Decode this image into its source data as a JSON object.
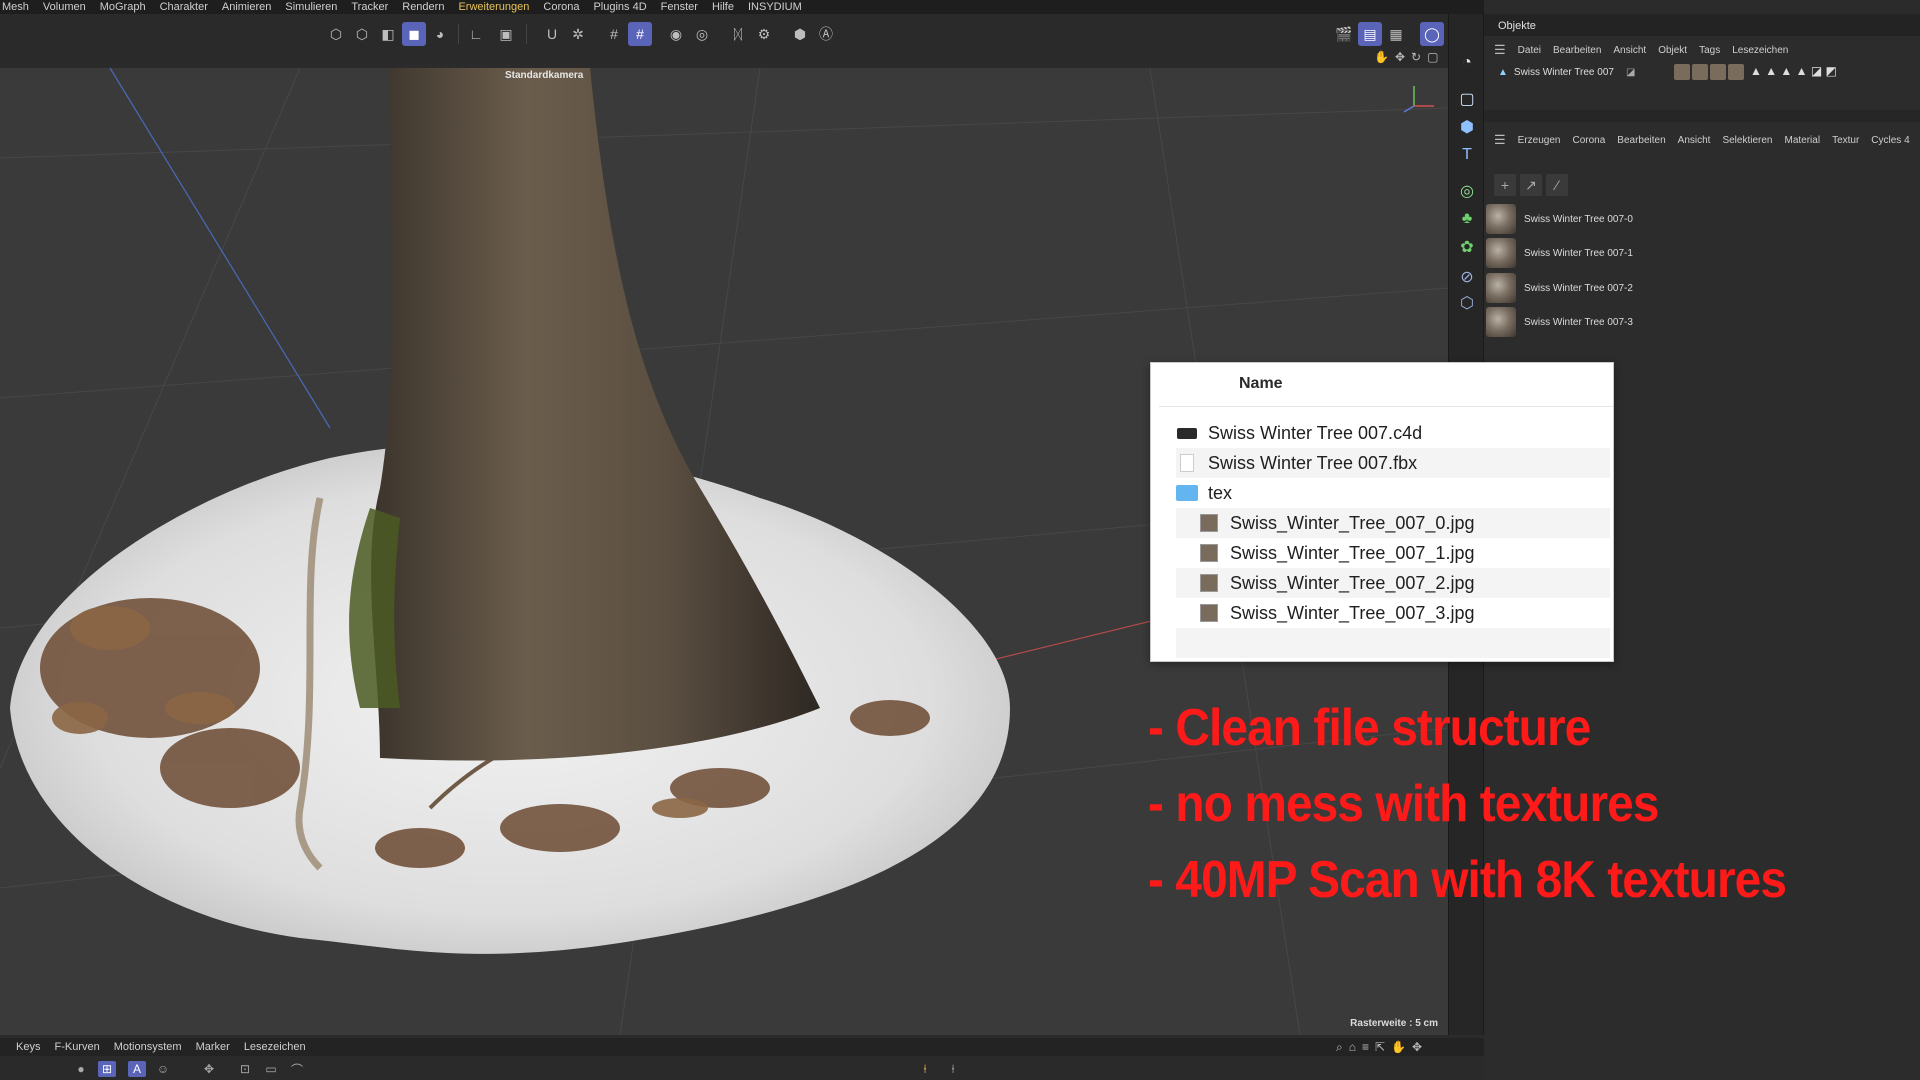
{
  "menubar": {
    "items": [
      "Mesh",
      "Volumen",
      "MoGraph",
      "Charakter",
      "Animieren",
      "Simulieren",
      "Tracker",
      "Rendern",
      "Erweiterungen",
      "Corona",
      "Plugins 4D",
      "Fenster",
      "Hilfe",
      "INSYDIUM"
    ],
    "active": "Erweiterungen"
  },
  "viewport": {
    "camera_label": "Standardkamera",
    "grid_spacing_label": "Rasterweite : 5 cm"
  },
  "objects_panel": {
    "tab": "Objekte",
    "menu": [
      "Datei",
      "Bearbeiten",
      "Ansicht",
      "Objekt",
      "Tags",
      "Lesezeichen"
    ],
    "object_name": "Swiss Winter Tree 007"
  },
  "materials_panel": {
    "menu": [
      "Erzeugen",
      "Corona",
      "Bearbeiten",
      "Ansicht",
      "Selektieren",
      "Material",
      "Textur",
      "Cycles 4"
    ],
    "materials": [
      "Swiss Winter Tree 007-0",
      "Swiss Winter Tree 007-1",
      "Swiss Winter Tree 007-2",
      "Swiss Winter Tree 007-3"
    ]
  },
  "timeline": {
    "menu": [
      "Keys",
      "F-Kurven",
      "Motionsystem",
      "Marker",
      "Lesezeichen"
    ]
  },
  "finder": {
    "column_header": "Name",
    "files": [
      {
        "name": "Swiss Winter Tree 007.c4d",
        "icon": "c4d-file-icon",
        "indent": 0
      },
      {
        "name": "Swiss Winter Tree 007.fbx",
        "icon": "blank-file-icon",
        "indent": 0
      },
      {
        "name": "tex",
        "icon": "folder-icon",
        "indent": 0,
        "expanded": true
      },
      {
        "name": "Swiss_Winter_Tree_007_0.jpg",
        "icon": "image-file-icon",
        "indent": 1
      },
      {
        "name": "Swiss_Winter_Tree_007_1.jpg",
        "icon": "image-file-icon",
        "indent": 1
      },
      {
        "name": "Swiss_Winter_Tree_007_2.jpg",
        "icon": "image-file-icon",
        "indent": 1
      },
      {
        "name": "Swiss_Winter_Tree_007_3.jpg",
        "icon": "image-file-icon",
        "indent": 1
      }
    ]
  },
  "promo": {
    "lines": [
      "- Clean file structure",
      "- no mess with textures",
      "- 40MP Scan with 8K textures"
    ],
    "color": "#ff1a1a"
  },
  "colors": {
    "accent": "#5a64b8",
    "viewport_bg": "#3a3a3a"
  }
}
